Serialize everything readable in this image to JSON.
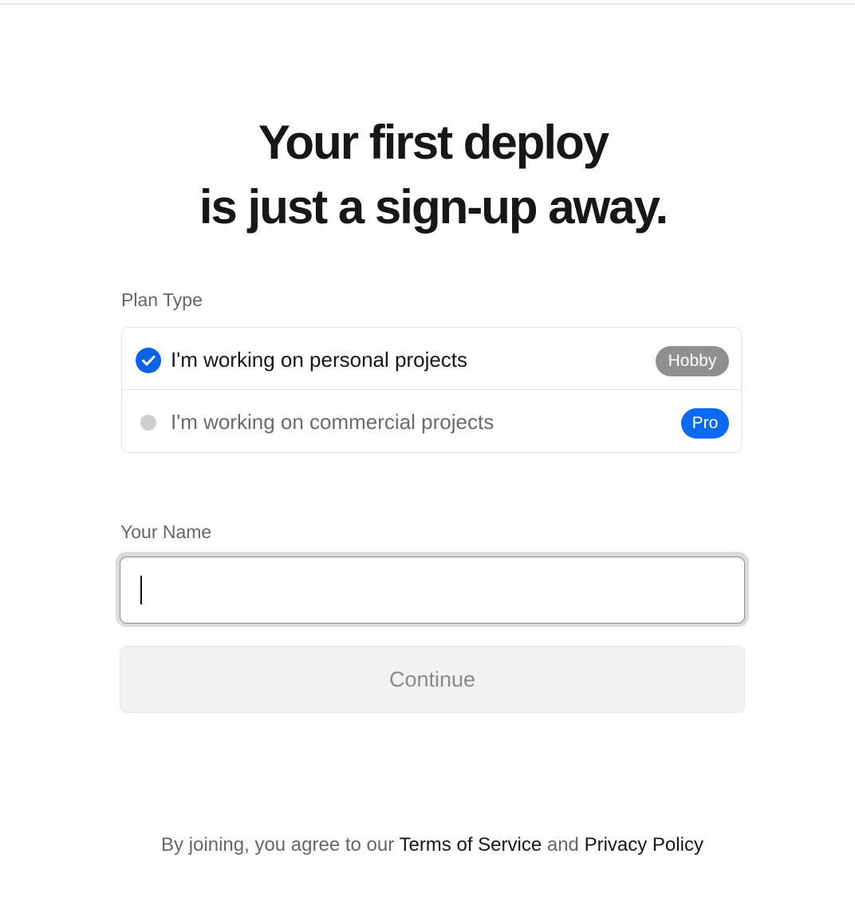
{
  "heading": {
    "line1": "Your first deploy",
    "line2": "is just a sign-up away."
  },
  "plan": {
    "label": "Plan Type",
    "options": [
      {
        "text": "I'm working on personal projects",
        "badge": "Hobby",
        "selected": true
      },
      {
        "text": "I'm working on commercial projects",
        "badge": "Pro",
        "selected": false
      }
    ]
  },
  "name_field": {
    "label": "Your Name",
    "value": "",
    "placeholder": ""
  },
  "continue_button": {
    "label": "Continue",
    "enabled": false
  },
  "legal": {
    "prefix": "By joining, you agree to our ",
    "terms_link": "Terms of Service",
    "conjunction": " and ",
    "privacy_link": "Privacy Policy"
  },
  "colors": {
    "accent": "#0a62e6",
    "hobby_badge": "#8f8f8f",
    "pro_badge": "#0a6af5"
  }
}
